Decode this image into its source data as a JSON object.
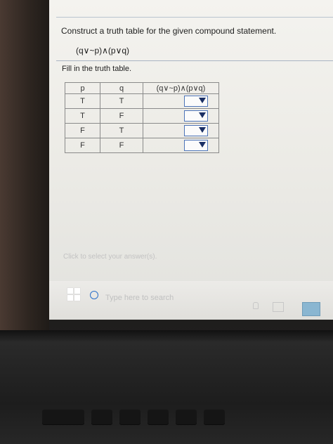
{
  "question": {
    "instruction": "Construct a truth table for the given compound statement.",
    "statement": "(q∨~p)∧(p∨q)"
  },
  "truth_table": {
    "label": "Fill in the truth table.",
    "headers": [
      "p",
      "q",
      "(q∨~p)∧(p∨q)"
    ],
    "rows": [
      {
        "p": "T",
        "q": "T"
      },
      {
        "p": "T",
        "q": "F"
      },
      {
        "p": "F",
        "q": "T"
      },
      {
        "p": "F",
        "q": "F"
      }
    ]
  },
  "hint": "Click to select your answer(s).",
  "taskbar": {
    "search_placeholder": "Type here to search"
  },
  "icons": {
    "start": "windows-logo-icon",
    "search": "search-circle-icon",
    "dropdown": "chevron-down-icon"
  },
  "colors": {
    "dropdown_border": "#4d74b8",
    "dropdown_arrow": "#1a2f64",
    "search_ring": "#2a6fc9"
  }
}
